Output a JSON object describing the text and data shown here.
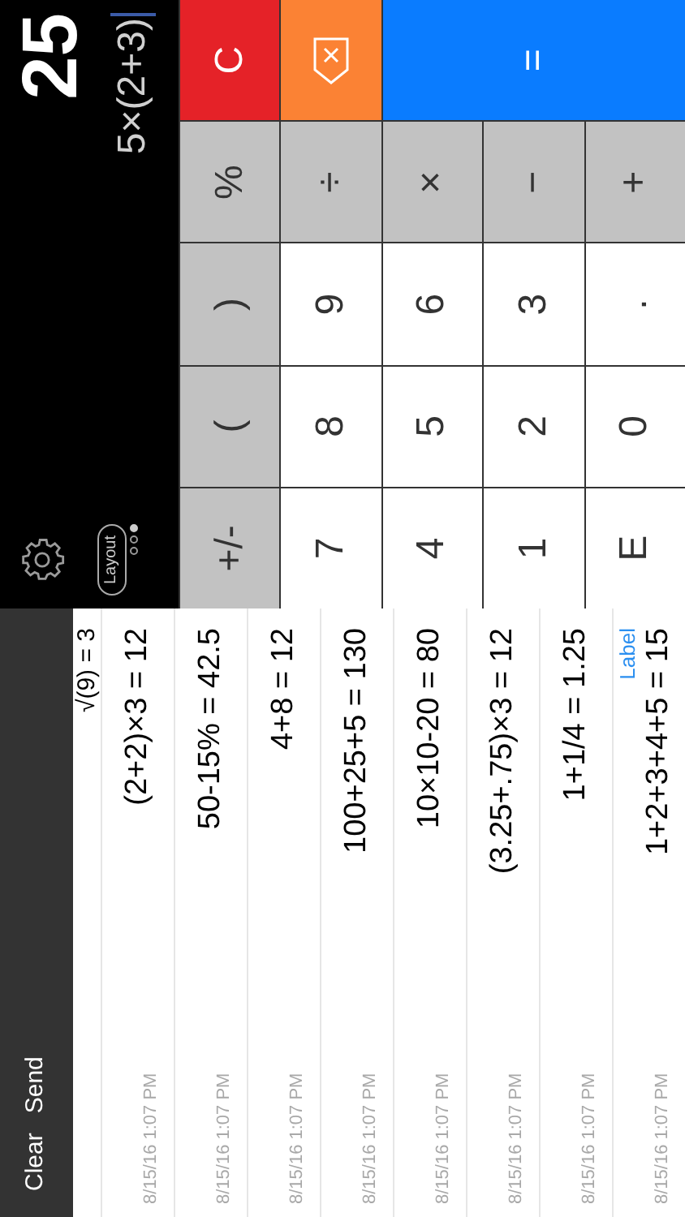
{
  "history_toolbar": {
    "buttons": [
      "Clear",
      "Send"
    ]
  },
  "history": [
    {
      "expression": "√(9) = 3"
    },
    {
      "date": "8/15/16 1:07 PM",
      "expression": "(2+2)×3 = 12"
    },
    {
      "date": "8/15/16 1:07 PM",
      "expression": "50-15% = 42.5"
    },
    {
      "date": "8/15/16 1:07 PM",
      "expression": "4+8 = 12"
    },
    {
      "date": "8/15/16 1:07 PM",
      "expression": "100+25+5 = 130"
    },
    {
      "date": "8/15/16 1:07 PM",
      "expression": "10×10-20 = 80"
    },
    {
      "date": "8/15/16 1:07 PM",
      "expression": "(3.25+.75)×3 = 12"
    },
    {
      "date": "8/15/16 1:07 PM",
      "expression": "1+1/4 = 1.25"
    },
    {
      "date": "8/15/16 1:07 PM",
      "label": "Label",
      "expression": "1+2+3+4+5 = 15"
    }
  ],
  "display": {
    "result": "25",
    "expression": "5×(2+3)",
    "layout_button": "Layout",
    "pages": [
      {
        "selected": false
      },
      {
        "selected": false
      },
      {
        "selected": true
      }
    ]
  },
  "keys": [
    {
      "kind": "function",
      "label": "+/-"
    },
    {
      "kind": "function",
      "label": "("
    },
    {
      "kind": "function",
      "label": ")"
    },
    {
      "kind": "function",
      "label": "%"
    },
    {
      "kind": "clear",
      "label": "C"
    },
    {
      "kind": "digit",
      "label": "7"
    },
    {
      "kind": "digit",
      "label": "8"
    },
    {
      "kind": "digit",
      "label": "9"
    },
    {
      "kind": "function",
      "label": "÷"
    },
    {
      "kind": "backspace"
    },
    {
      "kind": "digit",
      "label": "4"
    },
    {
      "kind": "digit",
      "label": "5"
    },
    {
      "kind": "digit",
      "label": "6"
    },
    {
      "kind": "function",
      "label": "×"
    },
    {
      "kind": "equals",
      "label": "="
    },
    {
      "kind": "digit",
      "label": "1"
    },
    {
      "kind": "digit",
      "label": "2"
    },
    {
      "kind": "digit",
      "label": "3"
    },
    {
      "kind": "function",
      "label": "−"
    },
    {
      "kind": "digit",
      "label": "E"
    },
    {
      "kind": "digit",
      "label": "0"
    },
    {
      "kind": "digit",
      "label": "."
    },
    {
      "kind": "function",
      "label": "+"
    }
  ]
}
